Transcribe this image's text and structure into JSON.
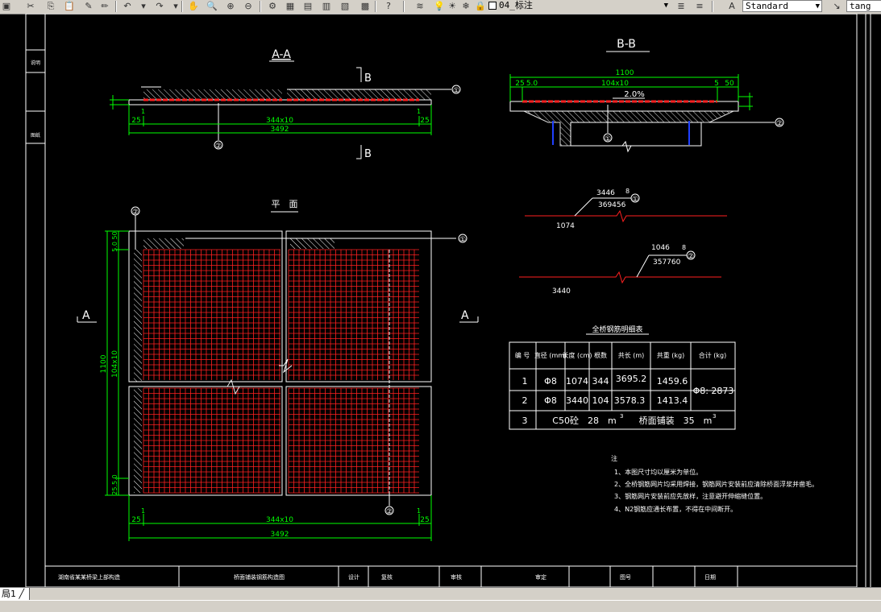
{
  "toolbar": {
    "layer_name": "04_标注",
    "text_style": "Standard",
    "dim_style": "tang"
  },
  "layout_tab": "局1",
  "section_aa": {
    "title": "A-A",
    "cut_mark": "B",
    "dim_total": "3492",
    "dim_mid": "344x10",
    "dim_left": "25",
    "dim_right": "25",
    "tick_left": "1",
    "tick_right": "1",
    "callout_1": "①",
    "callout_2": "②"
  },
  "section_bb": {
    "title": "B-B",
    "dim_total": "1100",
    "dim_mid": "104x10",
    "dim_left": "25",
    "dim_left2": "5.0",
    "dim_right": "5",
    "dim_right2": "50",
    "slope": "2.0%",
    "callout_1": "①",
    "callout_2": "②"
  },
  "plan": {
    "title": "平　面",
    "cut_mark": "A",
    "dim_bottom_total": "3492",
    "dim_bottom_mid": "344x10",
    "dim_left": "25",
    "dim_right": "25",
    "tick_left": "1",
    "tick_right": "1",
    "dim_side_total": "1100",
    "dim_side_mid": "104x10",
    "dim_side_top": "5.0 50",
    "dim_side_bottom": "25.5.0",
    "callout_1": "①",
    "callout_2": "②"
  },
  "bar1": {
    "label_top": "3446",
    "label_sub": "8",
    "dim": "369456",
    "length": "1074",
    "callout": "①"
  },
  "bar2": {
    "label_top": "1046",
    "label_sub": "8",
    "dim": "357760",
    "length": "3440",
    "callout": "②"
  },
  "table": {
    "title": "全桥钢筋明细表",
    "headers": [
      "编 号",
      "直径\n(mm)",
      "长度\n(cm)",
      "根数",
      "共长\n(m)",
      "共重\n(kg)",
      "合计\n(kg)"
    ],
    "rows": [
      [
        "1",
        "Φ8",
        "1074",
        "344",
        "3695.2",
        "1459.6"
      ],
      [
        "2",
        "Φ8",
        "3440",
        "104",
        "3578.3",
        "1413.4"
      ]
    ],
    "total": "Φ8: 2873",
    "row3_num": "3",
    "row3_left": "C50砼　28　m",
    "row3_right": "桥面铺装　35　m",
    "row3_sup": "3"
  },
  "notes": {
    "heading": "注",
    "items": [
      "1、本图尺寸均以厘米为单位。",
      "2、全桥钢筋网片均采用焊接，钢筋网片安装前应清除桥面浮浆并凿毛。",
      "3、钢筋网片安装前应先放样，注意避开伸缩缝位置。",
      "4、N2钢筋应通长布置，不得在中间断开。"
    ]
  },
  "title_block": {
    "cells": [
      "湖南省某某桥梁上部构造",
      "桥面铺装钢筋构造图",
      "设计",
      "复核",
      "审核",
      "审定",
      "图号",
      "日期"
    ]
  },
  "sidebar": [
    "说明",
    "图纸"
  ],
  "colors": {
    "green": "#00ff00",
    "red": "#ff2020",
    "white": "#ffffff",
    "blue": "#2040ff",
    "dim": "#00cc66"
  }
}
